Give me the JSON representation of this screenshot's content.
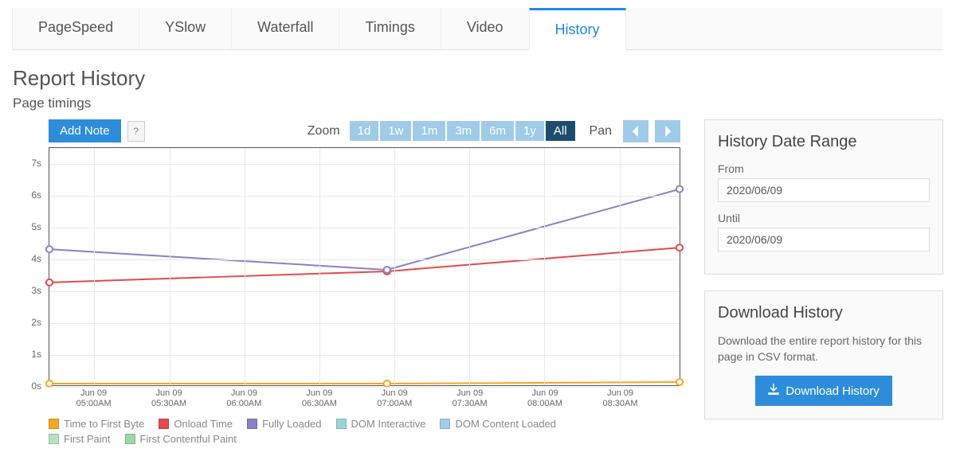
{
  "tabs": [
    "PageSpeed",
    "YSlow",
    "Waterfall",
    "Timings",
    "Video",
    "History"
  ],
  "active_tab": "History",
  "title": "Report History",
  "subtitle": "Page timings",
  "toolbar": {
    "add_note": "Add Note",
    "help": "?",
    "zoom_label": "Zoom",
    "zoom_buttons": [
      "1d",
      "1w",
      "1m",
      "3m",
      "6m",
      "1y",
      "All"
    ],
    "zoom_active": "All",
    "pan_label": "Pan"
  },
  "right": {
    "range_title": "History Date Range",
    "from_label": "From",
    "from_value": "2020/06/09",
    "until_label": "Until",
    "until_value": "2020/06/09",
    "download_title": "Download History",
    "download_desc": "Download the entire report history for this page in CSV format.",
    "download_btn": "Download History"
  },
  "chart_data": {
    "type": "line",
    "xlabel": "",
    "ylabel": "",
    "ylim": [
      0,
      7.5
    ],
    "y_ticks": [
      0,
      1,
      2,
      3,
      4,
      5,
      6,
      7
    ],
    "y_tick_labels": [
      "0s",
      "1s",
      "2s",
      "3s",
      "4s",
      "5s",
      "6s",
      "7s"
    ],
    "x_tick_labels": [
      "Jun 09\n05:00AM",
      "Jun 09\n05:30AM",
      "Jun 09\n06:00AM",
      "Jun 09\n06:30AM",
      "Jun 09\n07:00AM",
      "Jun 09\n07:30AM",
      "Jun 09\n08:00AM",
      "Jun 09\n08:30AM"
    ],
    "x_tick_positions": [
      0.0714,
      0.1905,
      0.3095,
      0.4286,
      0.5476,
      0.6667,
      0.7857,
      0.9048
    ],
    "data_x": [
      0,
      0.5357,
      1.0
    ],
    "series": [
      {
        "name": "Time to First Byte",
        "color": "#f5a623",
        "values": [
          0.05,
          0.05,
          0.1
        ],
        "markers": [
          true,
          true,
          true
        ]
      },
      {
        "name": "Onload Time",
        "color": "#e24b4b",
        "values": [
          3.25,
          3.6,
          4.35
        ],
        "markers": [
          true,
          true,
          true
        ]
      },
      {
        "name": "Fully Loaded",
        "color": "#8b7fc5",
        "values": [
          4.3,
          3.65,
          6.2
        ],
        "markers": [
          true,
          true,
          true
        ]
      },
      {
        "name": "DOM Interactive",
        "color": "#9bd6d6",
        "values": null
      },
      {
        "name": "DOM Content Loaded",
        "color": "#a7cbe8",
        "values": null
      },
      {
        "name": "First Paint",
        "color": "#b8e0c2",
        "values": null
      },
      {
        "name": "First Contentful Paint",
        "color": "#9cd8a7",
        "values": null
      }
    ]
  }
}
